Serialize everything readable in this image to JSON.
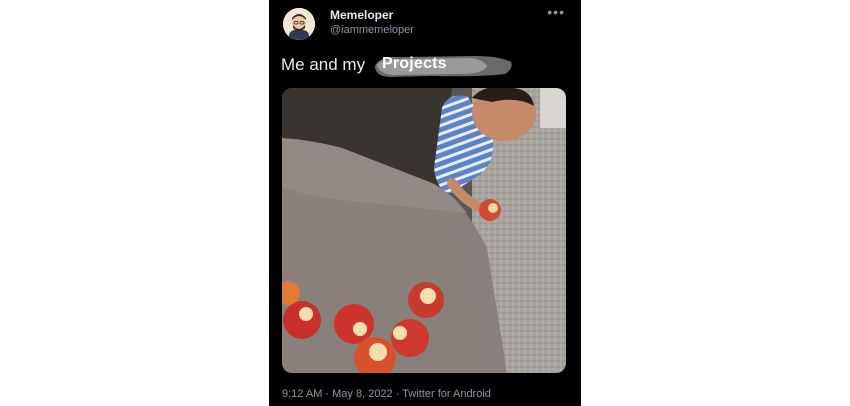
{
  "tweet": {
    "author_name": "Memeloper",
    "author_handle": "@iammemeloper",
    "more_icon": "more-horizontal-icon",
    "text_prefix": "Me and my",
    "text_highlight": "Projects",
    "timestamp": "9:12 AM · May 8, 2022 · Twitter for Android"
  },
  "colors": {
    "background": "#000000",
    "primary_text": "#e7e9ea",
    "secondary_text": "#8b98a5"
  }
}
